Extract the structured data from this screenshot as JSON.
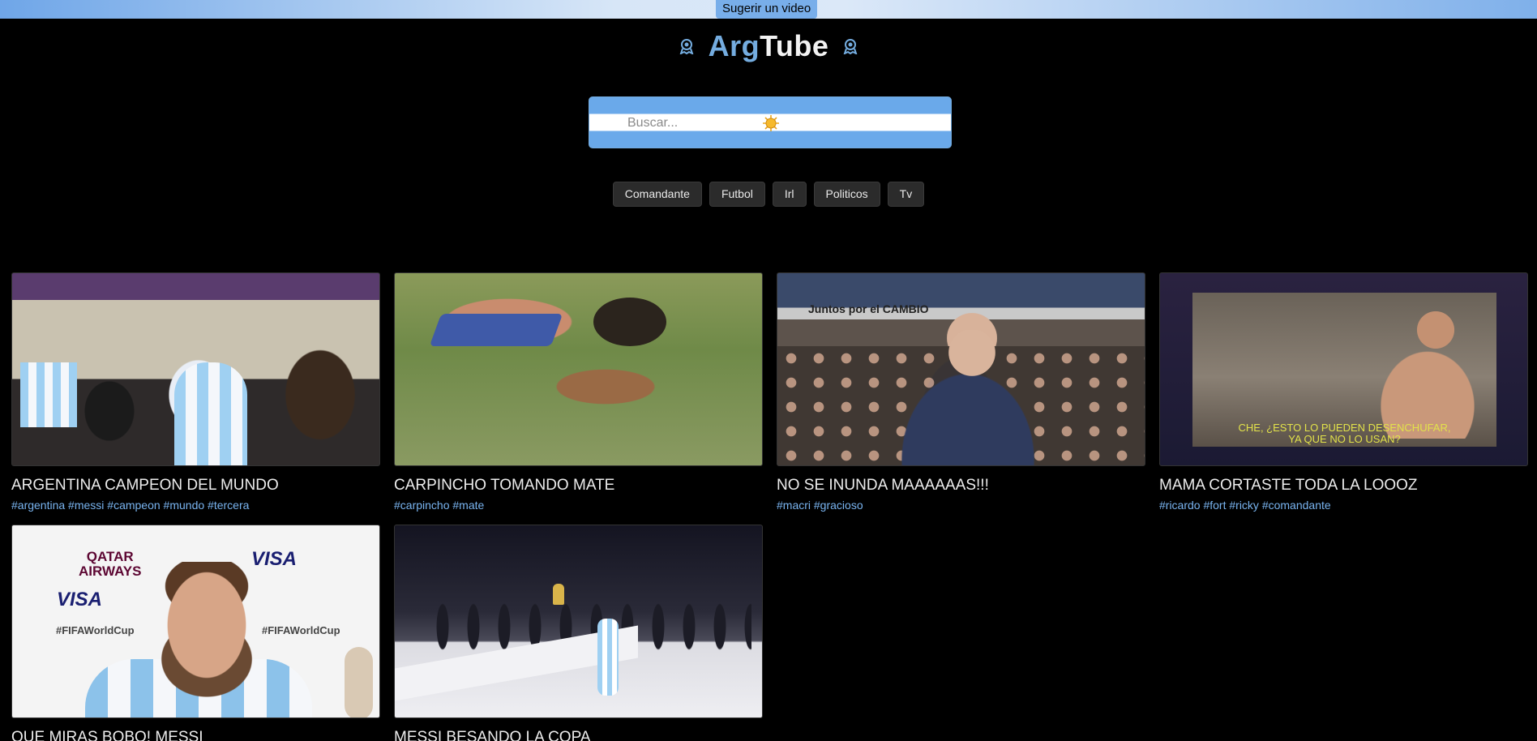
{
  "header": {
    "suggest_label": "Sugerir un video",
    "brand_part1": "Arg",
    "brand_part2": "Tube"
  },
  "search": {
    "placeholder": "Buscar...",
    "value": ""
  },
  "categories": [
    "Comandante",
    "Futbol",
    "Irl",
    "Politicos",
    "Tv"
  ],
  "videos": [
    {
      "title": "ARGENTINA CAMPEON DEL MUNDO",
      "tags": "#argentina #messi #campeon #mundo #tercera"
    },
    {
      "title": "CARPINCHO TOMANDO MATE",
      "tags": "#carpincho #mate"
    },
    {
      "title": "NO SE INUNDA MAAAAAAS!!!",
      "tags": "#macri #gracioso"
    },
    {
      "title": "MAMA CORTASTE TODA LA LOOOZ",
      "tags": "#ricardo #fort #ricky #comandante"
    },
    {
      "title": "QUE MIRAS BOBO! MESSI",
      "tags": ""
    },
    {
      "title": "MESSI BESANDO LA COPA",
      "tags": ""
    }
  ],
  "thumb_text": {
    "cambio_banner": "Juntos por el CAMBIO",
    "subtitle_line1": "CHE, ¿ESTO LO PUEDEN DESENCHUFAR,",
    "subtitle_line2": "YA QUE NO LO USAN?",
    "qatar_line1": "QATAR",
    "qatar_line2": "AIRWAYS",
    "visa": "VISA",
    "fifa_tag": "#FIFAWorldCup"
  },
  "colors": {
    "brand": "#74acdf",
    "tag_text": "#79b4f0",
    "flag_blue": "#6aa9ea",
    "background": "#000000"
  },
  "icons": {
    "brand_left": "sun-of-may-icon",
    "brand_right": "sun-of-may-icon",
    "search": "sun-of-may-icon"
  }
}
